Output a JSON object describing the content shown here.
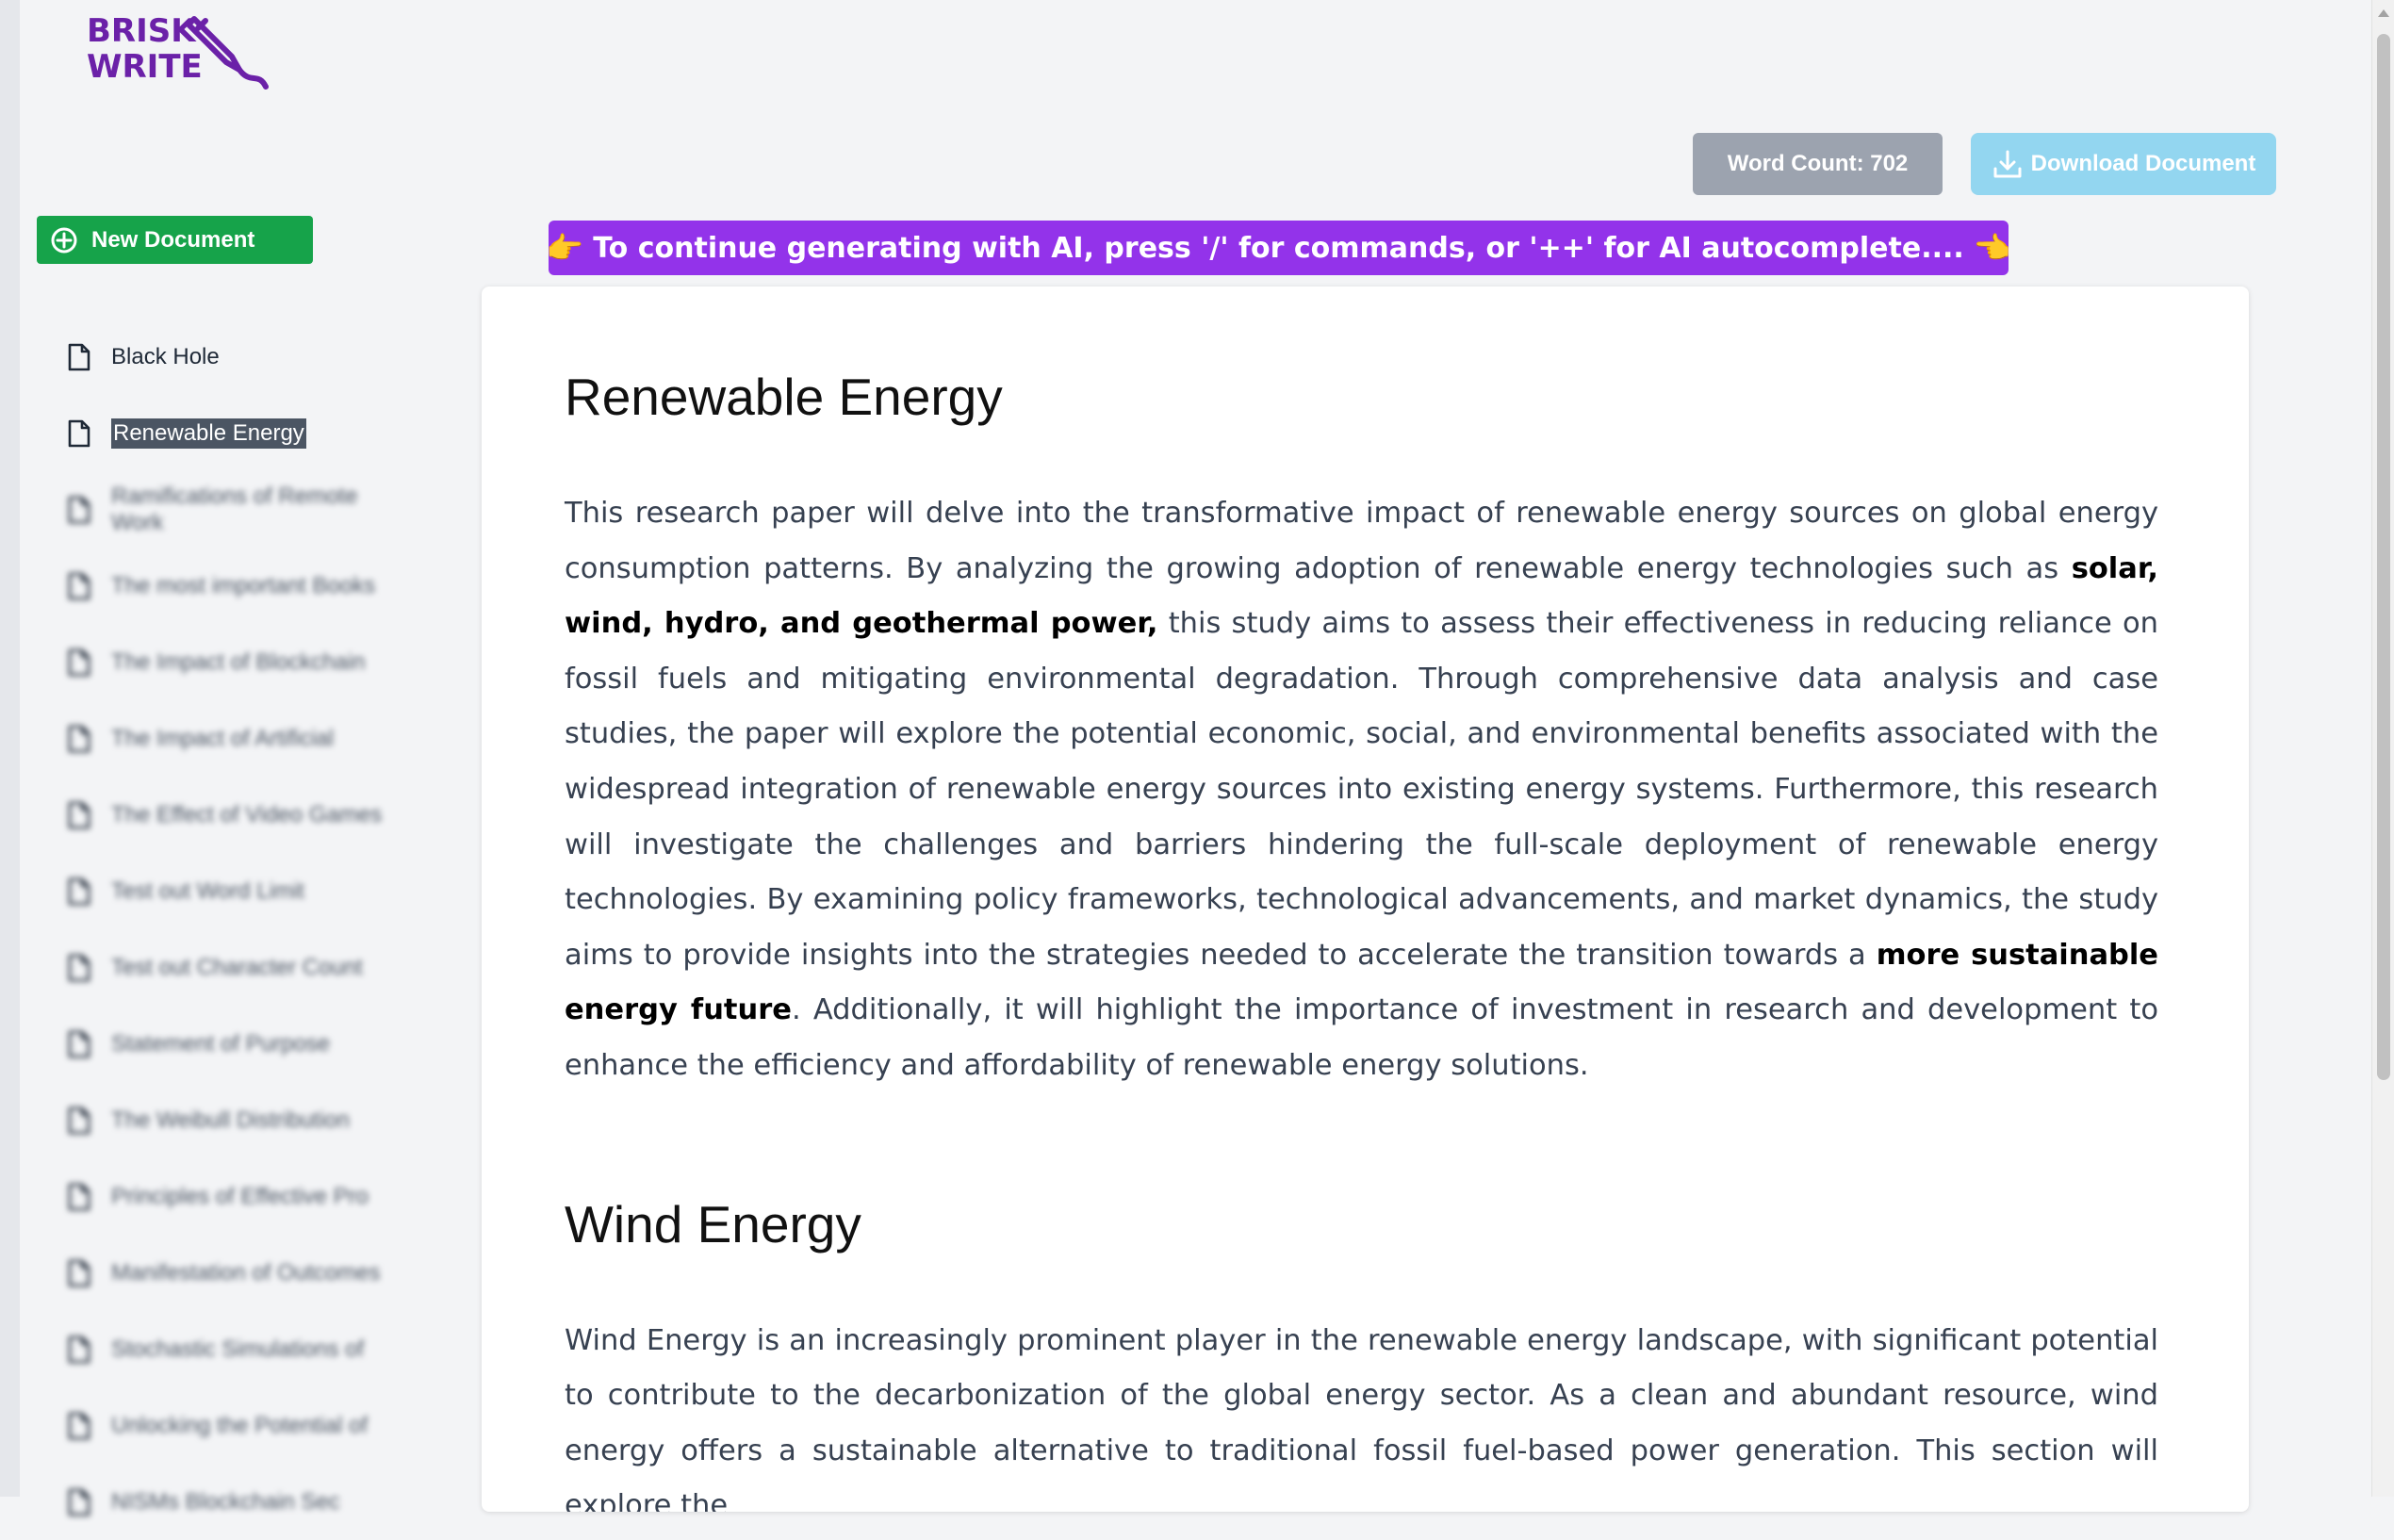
{
  "logo": {
    "line1": "BRISK",
    "line2": "WRITE"
  },
  "new_document_label": "New Document",
  "sidebar": {
    "items": [
      {
        "label": "Black Hole",
        "state": "normal"
      },
      {
        "label": "Renewable Energy",
        "state": "active"
      },
      {
        "label": "Ramifications of Remote Work",
        "state": "blurred"
      },
      {
        "label": "The most important Books",
        "state": "blurred"
      },
      {
        "label": "The Impact of Blockchain",
        "state": "blurred"
      },
      {
        "label": "The Impact of Artificial",
        "state": "blurred"
      },
      {
        "label": "The Effect of Video Games",
        "state": "blurred"
      },
      {
        "label": "Test out Word Limit",
        "state": "blurred"
      },
      {
        "label": "Test out Character Count",
        "state": "blurred"
      },
      {
        "label": "Statement of Purpose",
        "state": "blurred"
      },
      {
        "label": "The Weibull Distribution",
        "state": "blurred"
      },
      {
        "label": "Principles of Effective Pro",
        "state": "blurred"
      },
      {
        "label": "Manifestation of Outcomes",
        "state": "blurred"
      },
      {
        "label": "Stochastic Simulations of",
        "state": "blurred"
      },
      {
        "label": "Unlocking the Potential of",
        "state": "blurred"
      },
      {
        "label": "NISMs Blockchain Sec",
        "state": "blurred"
      }
    ]
  },
  "toolbar": {
    "word_count_label": "Word Count: 702",
    "download_label": "Download Document"
  },
  "ai_banner": {
    "text": "To continue generating with AI, press '/' for commands, or '++' for AI autocomplete....",
    "left_icon": "pointing-right-hand",
    "right_icon": "pointing-left-hand"
  },
  "document": {
    "h1": "Renewable Energy",
    "p1": {
      "a": "This research paper will delve into the transformative impact of renewable energy sources on global energy consumption patterns. By analyzing the growing adoption of renewable energy technologies such as ",
      "b": "solar, wind, hydro, and geothermal power,",
      "c": " this study aims to assess their effectiveness in reducing reliance on fossil fuels and mitigating environmental degradation. Through comprehensive data analysis and case studies, the paper will explore the potential economic, social, and environmental benefits associated with the widespread integration of renewable energy sources into existing energy systems. Furthermore, this research will investigate the challenges and barriers hindering the full-scale deployment of renewable energy technologies. By examining policy frameworks, technological advancements, and market dynamics, the study aims to provide insights into the strategies needed to accelerate the transition towards a ",
      "d": "more sustainable energy future",
      "e": ". Additionally, it will highlight the importance of investment in research and development to enhance the efficiency and affordability of renewable energy solutions."
    },
    "h2": "Wind Energy",
    "p2": "Wind Energy is an increasingly prominent player in the renewable energy landscape, with significant potential to contribute to the decarbonization of the global energy sector. As a clean and abundant resource, wind energy offers a sustainable alternative to traditional fossil fuel-based power generation. This section will explore the"
  },
  "colors": {
    "brand_purple": "#6b21a8",
    "banner_purple": "#9333ea",
    "new_doc_green": "#16a34a",
    "word_count_gray": "#9ca3af",
    "download_blue": "#93d6f0"
  }
}
